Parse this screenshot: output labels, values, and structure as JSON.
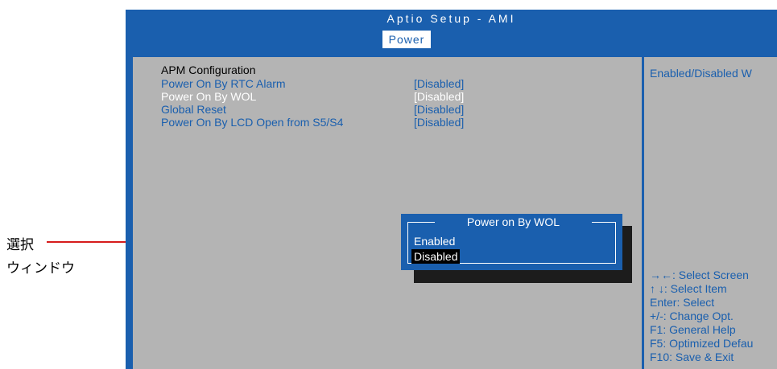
{
  "window": {
    "title": "Aptio Setup - AMI",
    "active_tab": "Power"
  },
  "main": {
    "heading": "APM Configuration",
    "items": [
      {
        "label": "Power On By RTC Alarm",
        "value": "[Disabled]",
        "selected": false
      },
      {
        "label": "Power On By WOL",
        "value": "[Disabled]",
        "selected": true
      },
      {
        "label": "Global Reset",
        "value": "[Disabled]",
        "selected": false
      },
      {
        "label": "Power On By LCD Open from S5/S4",
        "value": "[Disabled]",
        "selected": false
      }
    ]
  },
  "help": {
    "description": "Enabled/Disabled W",
    "keys": [
      "→←: Select Screen",
      "↑ ↓: Select Item",
      "Enter: Select",
      "+/-: Change Opt.",
      "F1: General Help",
      "F5: Optimized Defau",
      "F10: Save & Exit"
    ]
  },
  "popup": {
    "title": "Power on By WOL",
    "options": [
      "Enabled",
      "Disabled"
    ],
    "selected_index": 1
  },
  "annotation": {
    "line1": "選択",
    "line2": "ウィンドウ",
    "line_color": "#d61c1c"
  },
  "colors": {
    "bios_blue": "#1a5fae",
    "panel_gray": "#b4b4b4"
  }
}
